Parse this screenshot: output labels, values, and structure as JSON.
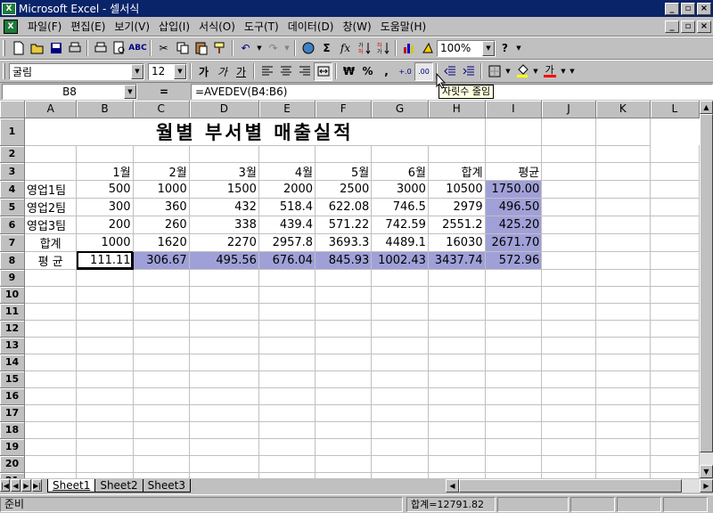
{
  "window": {
    "title": "Microsoft Excel - 셀서식",
    "minimize": "_",
    "restore": "▫",
    "close": "×"
  },
  "menu": [
    "파일(F)",
    "편집(E)",
    "보기(V)",
    "삽입(I)",
    "서식(O)",
    "도구(T)",
    "데이터(D)",
    "창(W)",
    "도움말(H)"
  ],
  "standard_toolbar": {
    "zoom": "100%"
  },
  "format_toolbar": {
    "font": "굴림",
    "size": "12",
    "bold": "가",
    "italic": "가",
    "underline": "가",
    "currency": "₩",
    "percent": "%",
    "comma": ",",
    "inc_decimal": "+.0",
    "dec_decimal": ".00",
    "font_color_label": "가"
  },
  "formula_bar": {
    "name_box": "B8",
    "equals": "=",
    "formula": "=AVEDEV(B4:B6)"
  },
  "tooltip": "자릿수 줄임",
  "columns": [
    "A",
    "B",
    "C",
    "D",
    "E",
    "F",
    "G",
    "H",
    "I",
    "J",
    "K",
    "L"
  ],
  "rows": [
    "1",
    "2",
    "3",
    "4",
    "5",
    "6",
    "7",
    "8",
    "9",
    "10",
    "11",
    "12",
    "13",
    "14",
    "15",
    "16",
    "17",
    "18",
    "19",
    "20",
    "21"
  ],
  "sheet": {
    "title": "월별 부서별 매출실적",
    "header": [
      "",
      "1월",
      "2월",
      "3월",
      "4월",
      "5월",
      "6월",
      "합계",
      "평균"
    ],
    "data": [
      [
        "영업1팀",
        "500",
        "1000",
        "1500",
        "2000",
        "2500",
        "3000",
        "10500",
        "1750.00"
      ],
      [
        "영업2팀",
        "300",
        "360",
        "432",
        "518.4",
        "622.08",
        "746.5",
        "2979",
        "496.50"
      ],
      [
        "영업3팀",
        "200",
        "260",
        "338",
        "439.4",
        "571.22",
        "742.59",
        "2551.2",
        "425.20"
      ],
      [
        "합계",
        "1000",
        "1620",
        "2270",
        "2957.8",
        "3693.3",
        "4489.1",
        "16030",
        "2671.70"
      ],
      [
        "평 균",
        "111.11",
        "306.67",
        "495.56",
        "676.04",
        "845.93",
        "1002.43",
        "3437.74",
        "572.96"
      ]
    ]
  },
  "tabs": [
    "Sheet1",
    "Sheet2",
    "Sheet3"
  ],
  "status": {
    "ready": "준비",
    "sum": "합계=12791.82"
  },
  "colors": {
    "title_bar": "#0a246a",
    "selection": "#a0a0d8",
    "chrome": "#c0c0c0"
  }
}
